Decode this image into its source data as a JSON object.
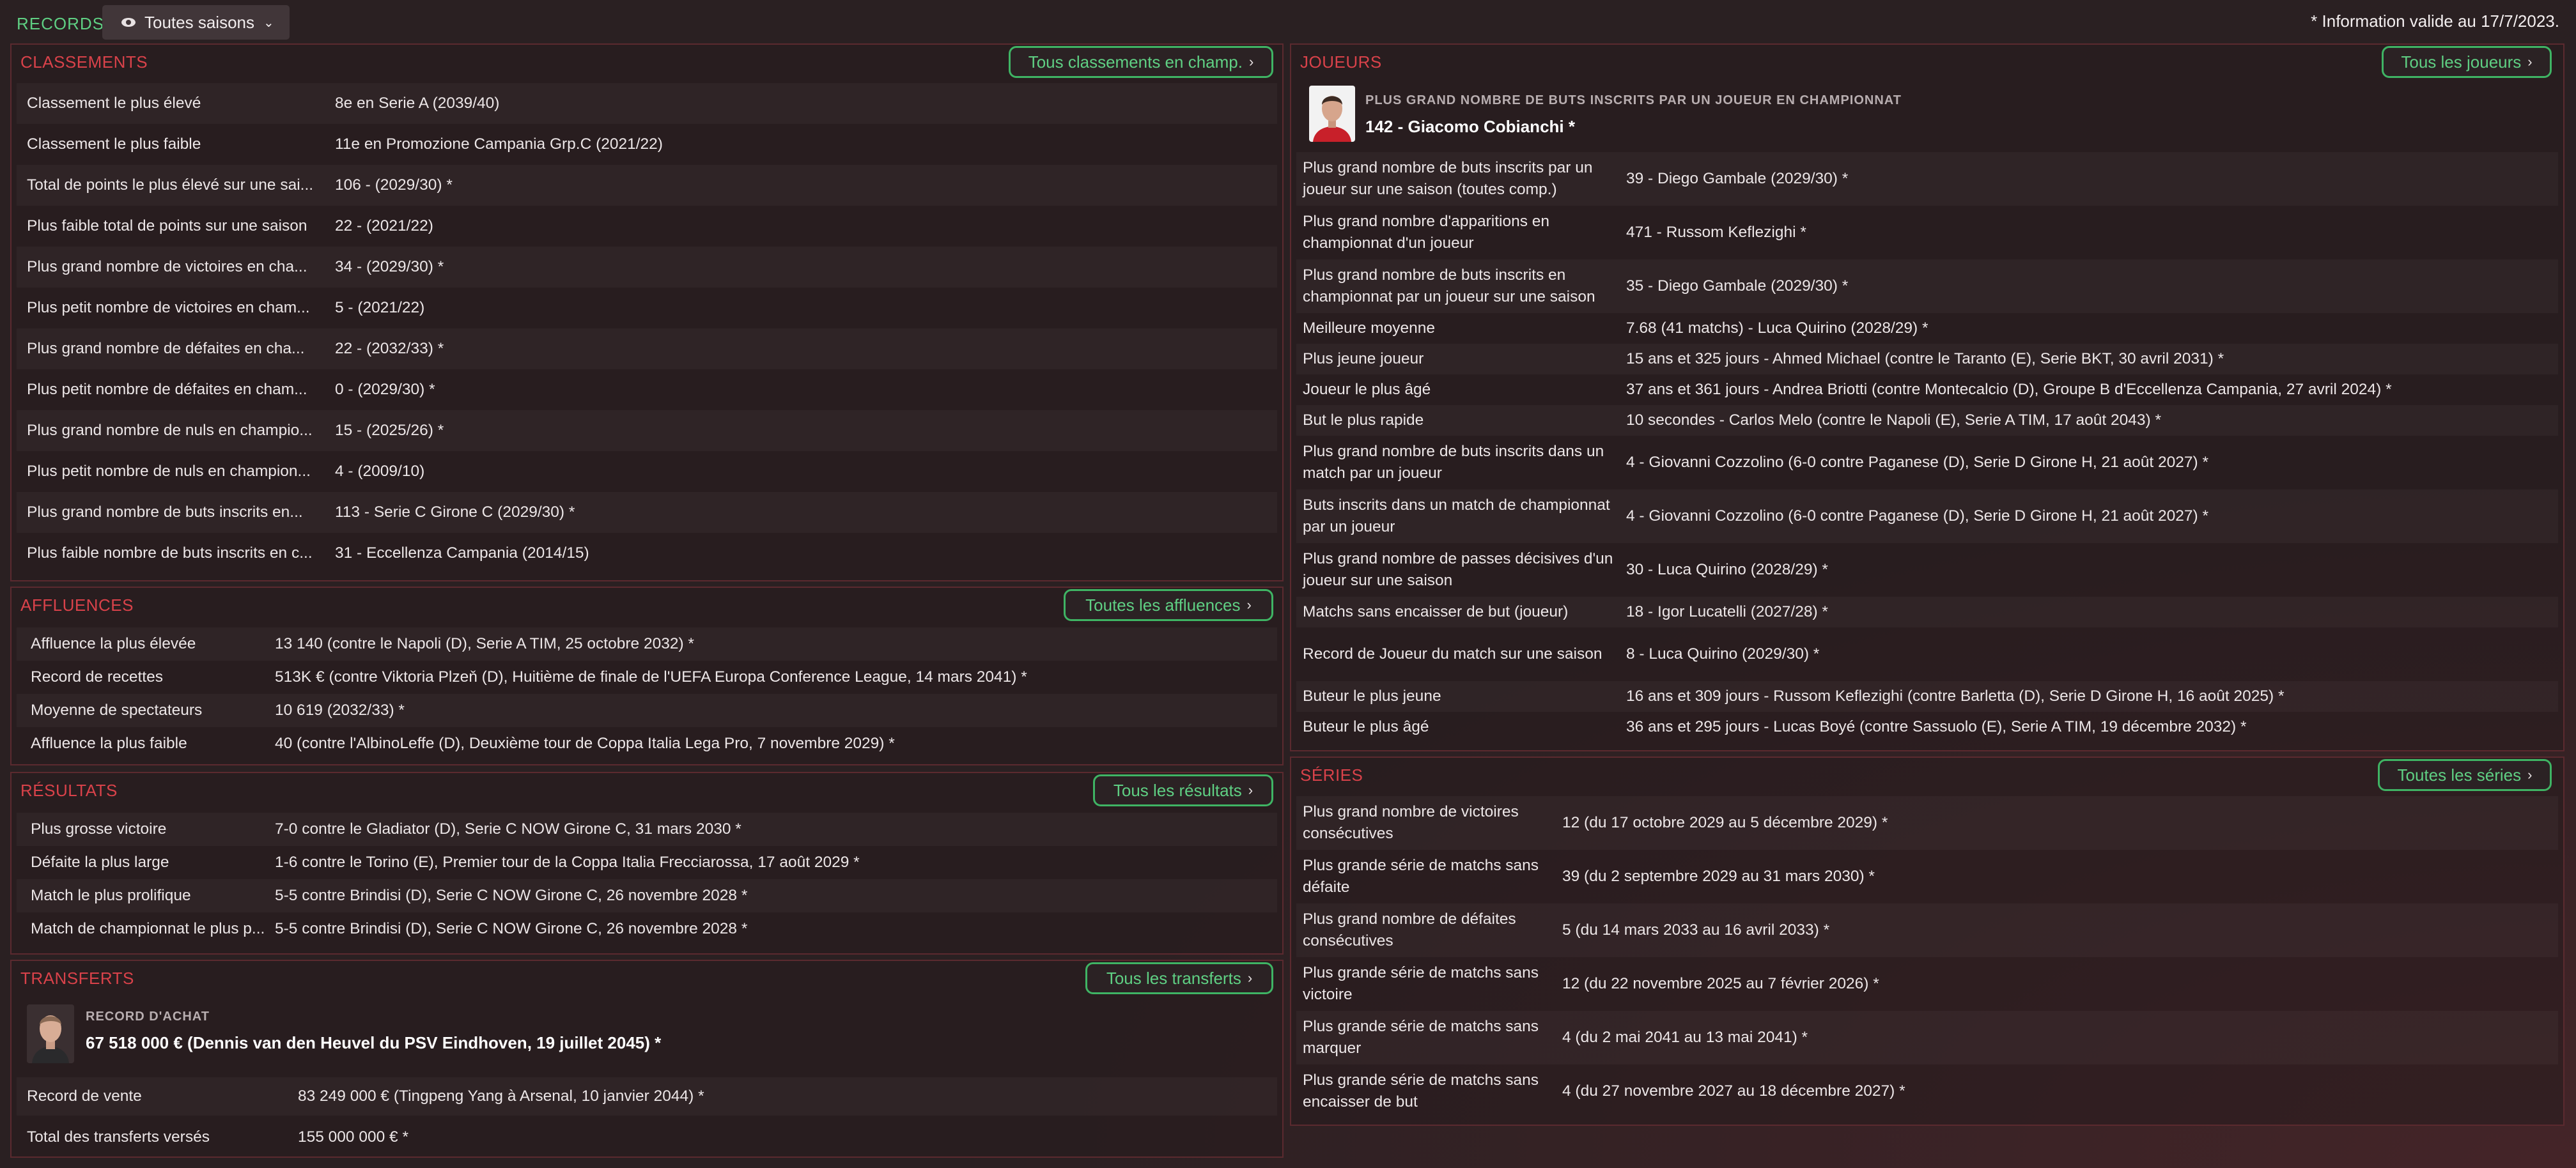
{
  "header": {
    "title": "RECORDS",
    "filter": "Toutes saisons",
    "note": "* Information valide au 17/7/2023."
  },
  "classements": {
    "title": "CLASSEMENTS",
    "button": "Tous classements en champ.",
    "rows": [
      {
        "label": "Classement le plus élevé",
        "value": "8e en Serie A (2039/40)"
      },
      {
        "label": "Classement le plus faible",
        "value": "11e en Promozione Campania Grp.C (2021/22)"
      },
      {
        "label": "Total de points le plus élevé sur une sai...",
        "value": "106 - (2029/30) *"
      },
      {
        "label": "Plus faible total de points sur une saison",
        "value": "22 - (2021/22)"
      },
      {
        "label": "Plus grand nombre de victoires en cha...",
        "value": "34 - (2029/30) *"
      },
      {
        "label": "Plus petit nombre de victoires en cham...",
        "value": "5 - (2021/22)"
      },
      {
        "label": "Plus grand nombre de défaites en cha...",
        "value": "22 - (2032/33) *"
      },
      {
        "label": "Plus petit nombre de défaites en cham...",
        "value": "0 - (2029/30) *"
      },
      {
        "label": "Plus grand nombre de nuls en champio...",
        "value": "15 - (2025/26) *"
      },
      {
        "label": "Plus petit nombre de nuls en champion...",
        "value": "4 - (2009/10)"
      },
      {
        "label": "Plus grand nombre de buts inscrits en...",
        "value": "113 - Serie C Girone C (2029/30) *"
      },
      {
        "label": "Plus faible nombre de buts inscrits en c...",
        "value": "31 - Eccellenza Campania (2014/15)"
      }
    ]
  },
  "affluences": {
    "title": "AFFLUENCES",
    "button": "Toutes les affluences",
    "rows": [
      {
        "label": "Affluence la plus élevée",
        "value": "13 140 (contre le Napoli (D), Serie A TIM, 25 octobre 2032) *"
      },
      {
        "label": "Record de recettes",
        "value": "513K € (contre Viktoria Plzeň (D), Huitième de finale de l'UEFA Europa Conference League, 14 mars 2041) *"
      },
      {
        "label": "Moyenne de spectateurs",
        "value": "10 619 (2032/33) *"
      },
      {
        "label": "Affluence la plus faible",
        "value": "40 (contre l'AlbinoLeffe (D), Deuxième tour de Coppa Italia Lega Pro, 7 novembre 2029) *"
      }
    ]
  },
  "resultats": {
    "title": "RÉSULTATS",
    "button": "Tous les résultats",
    "rows": [
      {
        "label": "Plus grosse victoire",
        "value": "7-0 contre le Gladiator (D), Serie C NOW Girone C, 31 mars 2030 *"
      },
      {
        "label": "Défaite la plus large",
        "value": "1-6 contre le Torino (E), Premier tour de la Coppa Italia Frecciarossa, 17 août 2029 *"
      },
      {
        "label": "Match le plus prolifique",
        "value": "5-5 contre Brindisi (D), Serie C NOW Girone C, 26 novembre 2028 *"
      },
      {
        "label": "Match de championnat le plus p...",
        "value": "5-5 contre Brindisi (D), Serie C NOW Girone C, 26 novembre 2028 *"
      }
    ]
  },
  "transferts": {
    "title": "TRANSFERTS",
    "button": "Tous les transferts",
    "hero_sub": "RECORD D'ACHAT",
    "hero_main": "67 518 000 € (Dennis van den Heuvel du PSV Eindhoven, 19 juillet 2045) *",
    "rows": [
      {
        "label": "Record de vente",
        "value": "83 249 000 € (Tingpeng Yang à Arsenal, 10 janvier 2044) *"
      },
      {
        "label": "Total des transferts versés",
        "value": "155 000 000 € *"
      }
    ]
  },
  "joueurs": {
    "title": "JOUEURS",
    "button": "Tous les joueurs",
    "hero_sub": "PLUS GRAND NOMBRE DE BUTS INSCRITS PAR UN JOUEUR EN CHAMPIONNAT",
    "hero_main": "142 - Giacomo Cobianchi *",
    "rows": [
      {
        "label": "Plus grand nombre de buts inscrits par un joueur sur une saison (toutes comp.)",
        "value": "39 - Diego Gambale (2029/30) *"
      },
      {
        "label": "Plus grand nombre d'apparitions en championnat d'un joueur",
        "value": "471 - Russom Keflezighi *"
      },
      {
        "label": "Plus grand nombre de buts inscrits en championnat par un joueur sur une saison",
        "value": "35 - Diego Gambale (2029/30) *"
      },
      {
        "label": "Meilleure moyenne",
        "value": "7.68 (41 matchs) - Luca Quirino (2028/29) *"
      },
      {
        "label": "Plus jeune joueur",
        "value": "15 ans et 325 jours - Ahmed Michael (contre le Taranto (E), Serie BKT, 30 avril 2031) *"
      },
      {
        "label": "Joueur le plus âgé",
        "value": "37 ans et 361 jours - Andrea Briotti (contre Montecalcio (D), Groupe B d'Eccellenza Campania, 27 avril 2024) *"
      },
      {
        "label": "But le plus rapide",
        "value": "10 secondes - Carlos Melo (contre le Napoli (E), Serie A TIM, 17 août 2043) *"
      },
      {
        "label": "Plus grand nombre de buts inscrits dans un match par un joueur",
        "value": "4 - Giovanni Cozzolino (6-0 contre Paganese (D), Serie D Girone H, 21 août 2027) *"
      },
      {
        "label": "Buts inscrits dans un match de championnat par un joueur",
        "value": "4 - Giovanni Cozzolino (6-0 contre Paganese (D), Serie D Girone H, 21 août 2027) *"
      },
      {
        "label": "Plus grand nombre de passes décisives d'un joueur sur une saison",
        "value": "30 - Luca Quirino (2028/29) *"
      },
      {
        "label": "Matchs sans encaisser de but (joueur)",
        "value": "18 - Igor Lucatelli (2027/28) *"
      },
      {
        "label": "Record de Joueur du match sur une saison",
        "value": "8 - Luca Quirino (2029/30) *"
      },
      {
        "label": "Buteur le plus jeune",
        "value": "16 ans et 309 jours - Russom Keflezighi (contre Barletta (D), Serie D Girone H, 16 août 2025) *"
      },
      {
        "label": "Buteur le plus âgé",
        "value": "36 ans et 295 jours - Lucas Boyé (contre Sassuolo (E), Serie A TIM, 19 décembre 2032) *"
      }
    ]
  },
  "series": {
    "title": "SÉRIES",
    "button": "Toutes les séries",
    "rows": [
      {
        "label": "Plus grand nombre de victoires consécutives",
        "value": "12 (du 17 octobre 2029 au 5 décembre 2029) *"
      },
      {
        "label": "Plus grande série de matchs sans défaite",
        "value": "39 (du 2 septembre 2029 au 31 mars 2030) *"
      },
      {
        "label": "Plus grand nombre de défaites consécutives",
        "value": "5 (du 14 mars 2033 au 16 avril 2033) *"
      },
      {
        "label": "Plus grande série de matchs sans victoire",
        "value": "12 (du 22 novembre 2025 au 7 février 2026) *"
      },
      {
        "label": "Plus grande série de matchs sans marquer",
        "value": "4 (du 2 mai 2041 au 13 mai 2041) *"
      },
      {
        "label": "Plus grande série de matchs sans encaisser de but",
        "value": "4 (du 27 novembre 2027 au 18 décembre 2027) *"
      }
    ]
  },
  "colors": {
    "accent_green": "#5fcf83",
    "accent_red": "#d9424a",
    "panel_border": "#5b2a2f"
  },
  "icons": {
    "filter": "eye-icon",
    "dropdown": "chevron-down-icon",
    "button_arrow": "chevron-right-icon"
  }
}
